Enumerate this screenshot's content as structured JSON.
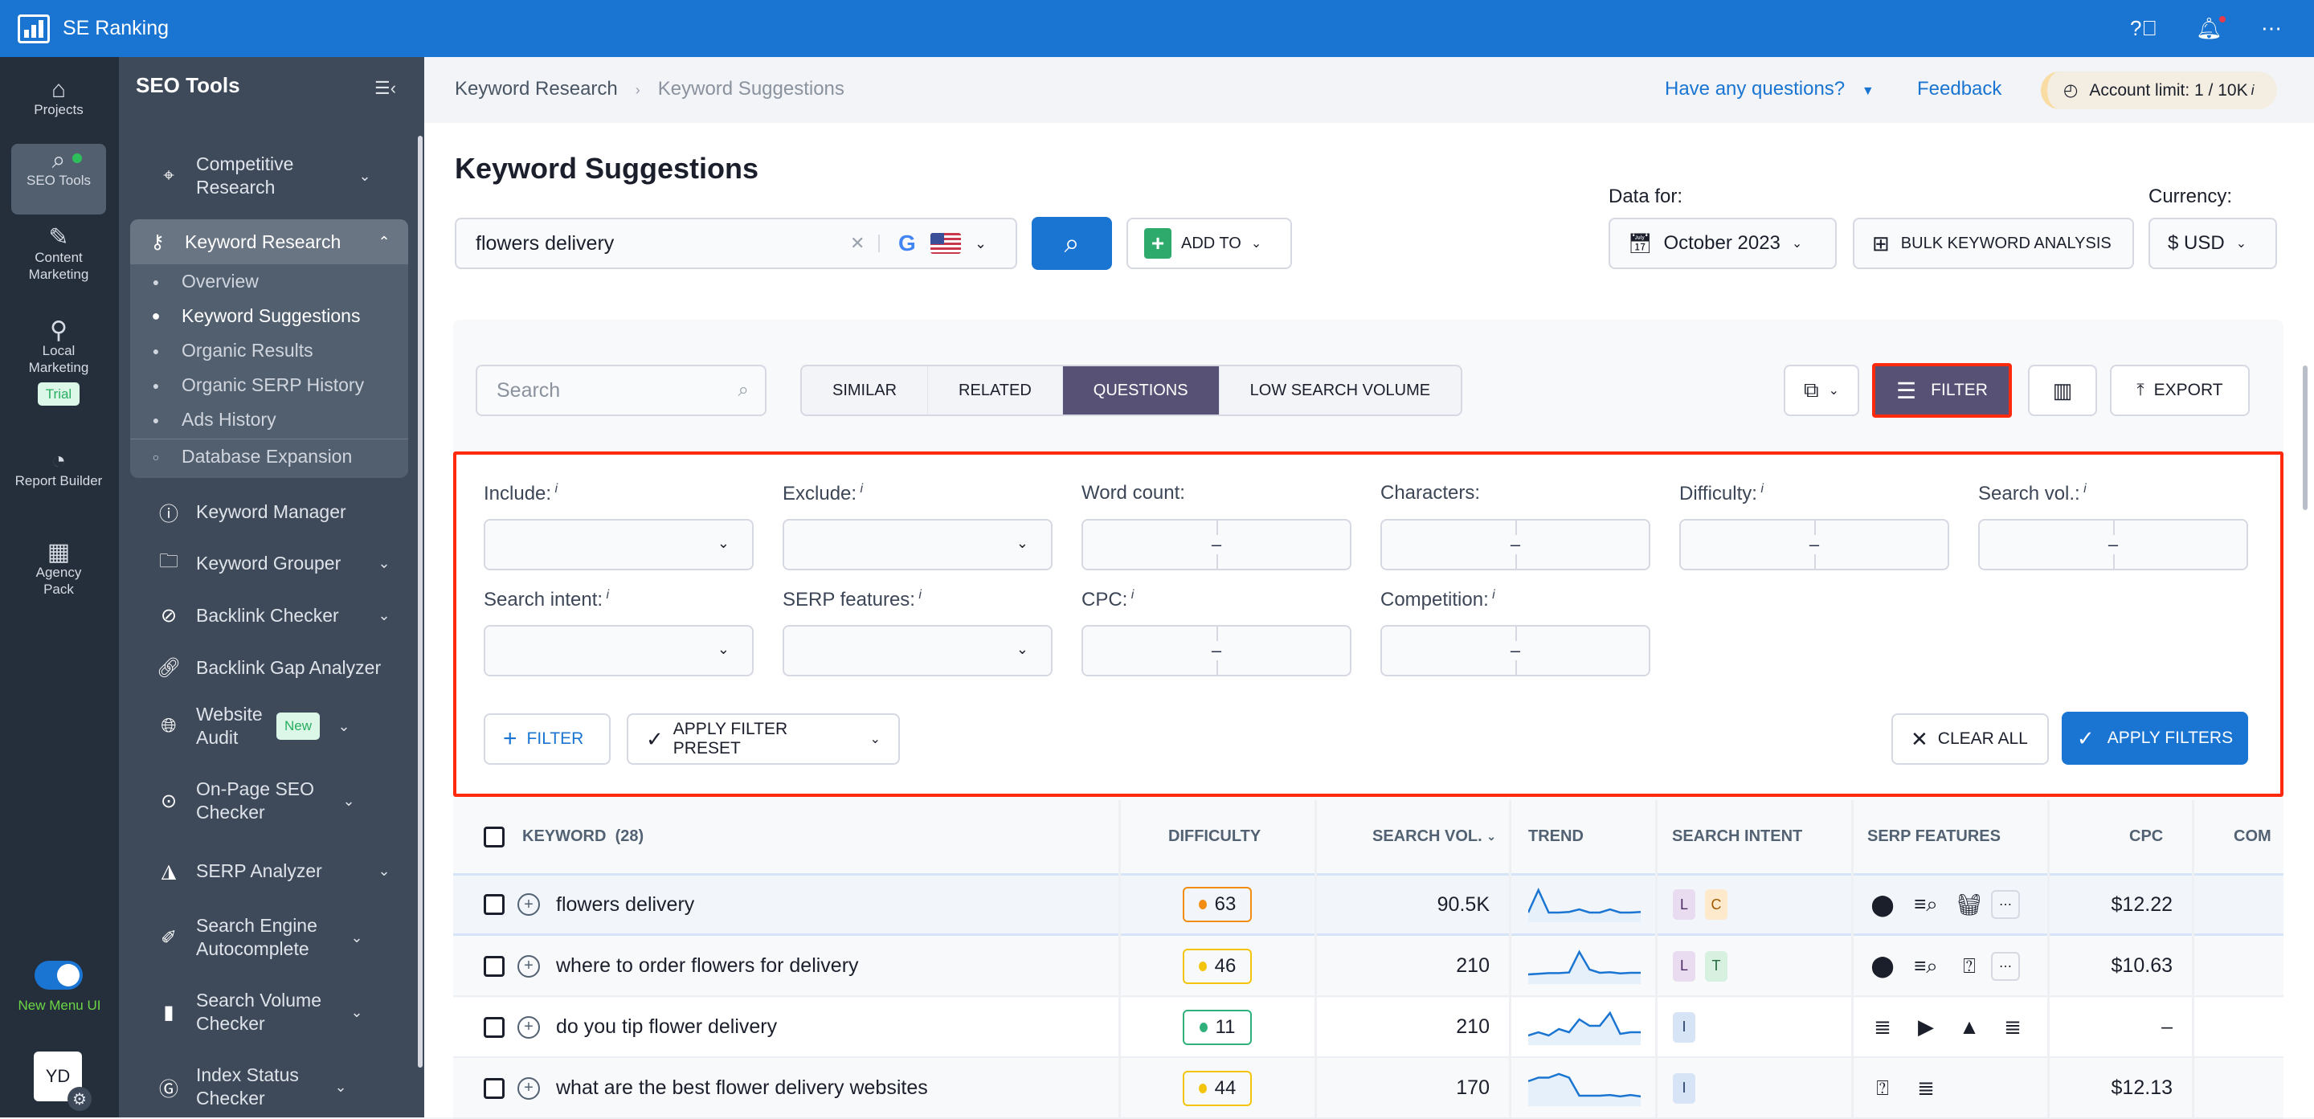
{
  "app": {
    "brand": "SE Ranking"
  },
  "topbar": {
    "icons": [
      "help-icon",
      "bell-icon",
      "more-icon"
    ]
  },
  "rail": {
    "items": [
      {
        "label": "Projects",
        "icon": "home-icon"
      },
      {
        "label": "SEO Tools",
        "icon": "search-icon",
        "active": true
      },
      {
        "label": "Content Marketing",
        "icon": "edit-icon"
      },
      {
        "label": "Local Marketing",
        "icon": "pin-icon",
        "badge": "Trial"
      },
      {
        "label": "Report Builder",
        "icon": "pie-icon"
      },
      {
        "label": "Agency Pack",
        "icon": "building-icon"
      }
    ],
    "toggle_label": "New Menu UI",
    "toggle_on": true,
    "avatar": "YD"
  },
  "sidebar": {
    "title": "SEO Tools",
    "items": [
      {
        "label": "Competitive Research",
        "icon": "target-icon"
      },
      {
        "label": "Keyword Research",
        "icon": "key-icon",
        "expanded": true
      },
      {
        "label": "Keyword Manager",
        "icon": "keyhole-icon"
      },
      {
        "label": "Keyword Grouper",
        "icon": "folder-plus-icon"
      },
      {
        "label": "Backlink Checker",
        "icon": "compass-icon"
      },
      {
        "label": "Backlink Gap Analyzer",
        "icon": "link-plus-icon"
      },
      {
        "label": "Website Audit",
        "icon": "globe-icon",
        "badge": "New"
      },
      {
        "label": "On-Page SEO Checker",
        "icon": "search-target-icon"
      },
      {
        "label": "SERP Analyzer",
        "icon": "chart-area-icon"
      },
      {
        "label": "Search Engine Autocomplete",
        "icon": "pencil-icon"
      },
      {
        "label": "Search Volume Checker",
        "icon": "bars-icon"
      },
      {
        "label": "Index Status Checker",
        "icon": "google-icon"
      }
    ],
    "subitems": [
      "Overview",
      "Keyword Suggestions",
      "Organic Results",
      "Organic SERP History",
      "Ads History",
      "Database Expansion"
    ],
    "active_sub": "Keyword Suggestions"
  },
  "header": {
    "breadcrumb": [
      "Keyword Research",
      "Keyword Suggestions"
    ],
    "help": "Have any questions?",
    "feedback": "Feedback",
    "limit": "Account limit: 1 / 10K"
  },
  "page": {
    "title": "Keyword Suggestions",
    "keyword": "flowers delivery",
    "add_to": "ADD TO",
    "data_for_label": "Data for:",
    "date": "October 2023",
    "bulk": "BULK KEYWORD ANALYSIS",
    "currency_label": "Currency:",
    "currency": "$ USD"
  },
  "toolbar": {
    "search_placeholder": "Search",
    "tabs": [
      "SIMILAR",
      "RELATED",
      "QUESTIONS",
      "LOW SEARCH VOLUME"
    ],
    "active_tab": "QUESTIONS",
    "filter": "FILTER",
    "export": "EXPORT"
  },
  "filters": {
    "row1": [
      "Include:",
      "Exclude:",
      "Word count:",
      "Characters:",
      "Difficulty:",
      "Search vol.:"
    ],
    "row1_info": [
      true,
      true,
      false,
      false,
      true,
      true
    ],
    "row2": [
      "Search intent:",
      "SERP features:",
      "CPC:",
      "Competition:"
    ],
    "row2_info": [
      true,
      true,
      true,
      true
    ],
    "add_filter": "FILTER",
    "preset": "APPLY FILTER PRESET",
    "clear": "CLEAR ALL",
    "apply": "APPLY FILTERS"
  },
  "table": {
    "headers": {
      "keyword": "KEYWORD",
      "count": "(28)",
      "difficulty": "DIFFICULTY",
      "volume": "SEARCH VOL.",
      "trend": "TREND",
      "intent": "SEARCH INTENT",
      "serp": "SERP FEATURES",
      "cpc": "CPC",
      "comp": "COM"
    },
    "rows": [
      {
        "keyword": "flowers delivery",
        "difficulty": "63",
        "diff_color": "#f28c12",
        "volume": "90.5K",
        "trend": [
          2,
          9,
          2,
          2,
          2.2,
          3,
          2,
          2,
          3,
          2,
          2,
          2.2
        ],
        "intent": [
          "L",
          "C"
        ],
        "serp": [
          "pin-icon",
          "search-list-icon",
          "basket-icon"
        ],
        "more": true,
        "cpc": "$12.22"
      },
      {
        "keyword": "where to order flowers for delivery",
        "difficulty": "46",
        "diff_color": "#f2c40c",
        "volume": "210",
        "trend": [
          2,
          2.2,
          2.4,
          2.4,
          2.6,
          9,
          3.5,
          2.5,
          2.7,
          2.3,
          2.5,
          2.5
        ],
        "intent": [
          "L",
          "T"
        ],
        "serp": [
          "pin-icon",
          "search-list-icon",
          "faq-icon"
        ],
        "more": true,
        "cpc": "$10.63"
      },
      {
        "keyword": "do you tip flower delivery",
        "difficulty": "11",
        "diff_color": "#2fb07a",
        "volume": "210",
        "trend": [
          2,
          3,
          2,
          4,
          3,
          7,
          5,
          5,
          9,
          2.5,
          3,
          3
        ],
        "intent": [
          "I"
        ],
        "serp": [
          "list-icon",
          "video-icon",
          "image-icon",
          "list-icon"
        ],
        "more": false,
        "cpc": "–"
      },
      {
        "keyword": "what are the best flower delivery websites",
        "difficulty": "44",
        "diff_color": "#f2c40c",
        "volume": "170",
        "trend": [
          6,
          7,
          7,
          8,
          7,
          2,
          2,
          2,
          2.2,
          1.8,
          2.2,
          1.8
        ],
        "intent": [
          "I"
        ],
        "serp": [
          "faq-icon",
          "list-icon"
        ],
        "more": false,
        "cpc": "$12.13"
      }
    ]
  }
}
